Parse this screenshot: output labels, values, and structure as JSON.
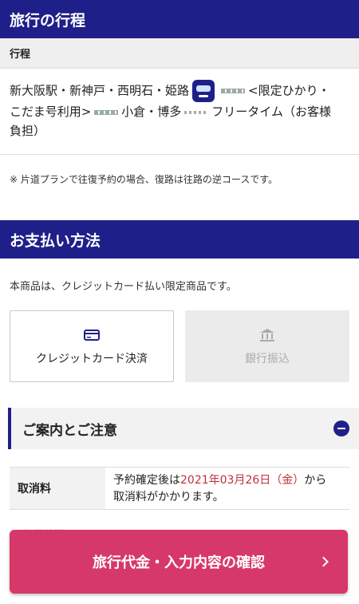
{
  "itinerary_section": {
    "title": "旅行の行程",
    "sub_title": "行程",
    "route_part1": "新大阪駅・新神戸・西明石・姫路",
    "route_part2": "<限定ひかり・",
    "route_part3": "こだま号利用>",
    "route_part4": "小倉・博多",
    "route_part5": "フリータイム（お客様",
    "route_part6": "負担）",
    "note": "※ 片道プランで往復予約の場合、復路は往路の逆コースです。"
  },
  "payment_section": {
    "title": "お支払い方法",
    "description": "本商品は、クレジットカード払い限定商品です。",
    "options": [
      {
        "label": "クレジットカード決済",
        "icon": "credit-card-icon",
        "enabled": true
      },
      {
        "label": "銀行振込",
        "icon": "bank-icon",
        "enabled": false
      }
    ]
  },
  "notice_section": {
    "title": "ご案内とご注意",
    "fee_label": "取消料",
    "fee_text1": "予約確定後は",
    "fee_date": "2021年03月26日（金）",
    "fee_text2": "から",
    "fee_text3": "取消料がかかります。",
    "faded": "旅行期間"
  },
  "confirm_button": {
    "label": "旅行代金・入力内容の確認"
  },
  "colors": {
    "header": "#1f1f8a",
    "accent_button": "#d6386a",
    "date_red": "#c0303b"
  }
}
